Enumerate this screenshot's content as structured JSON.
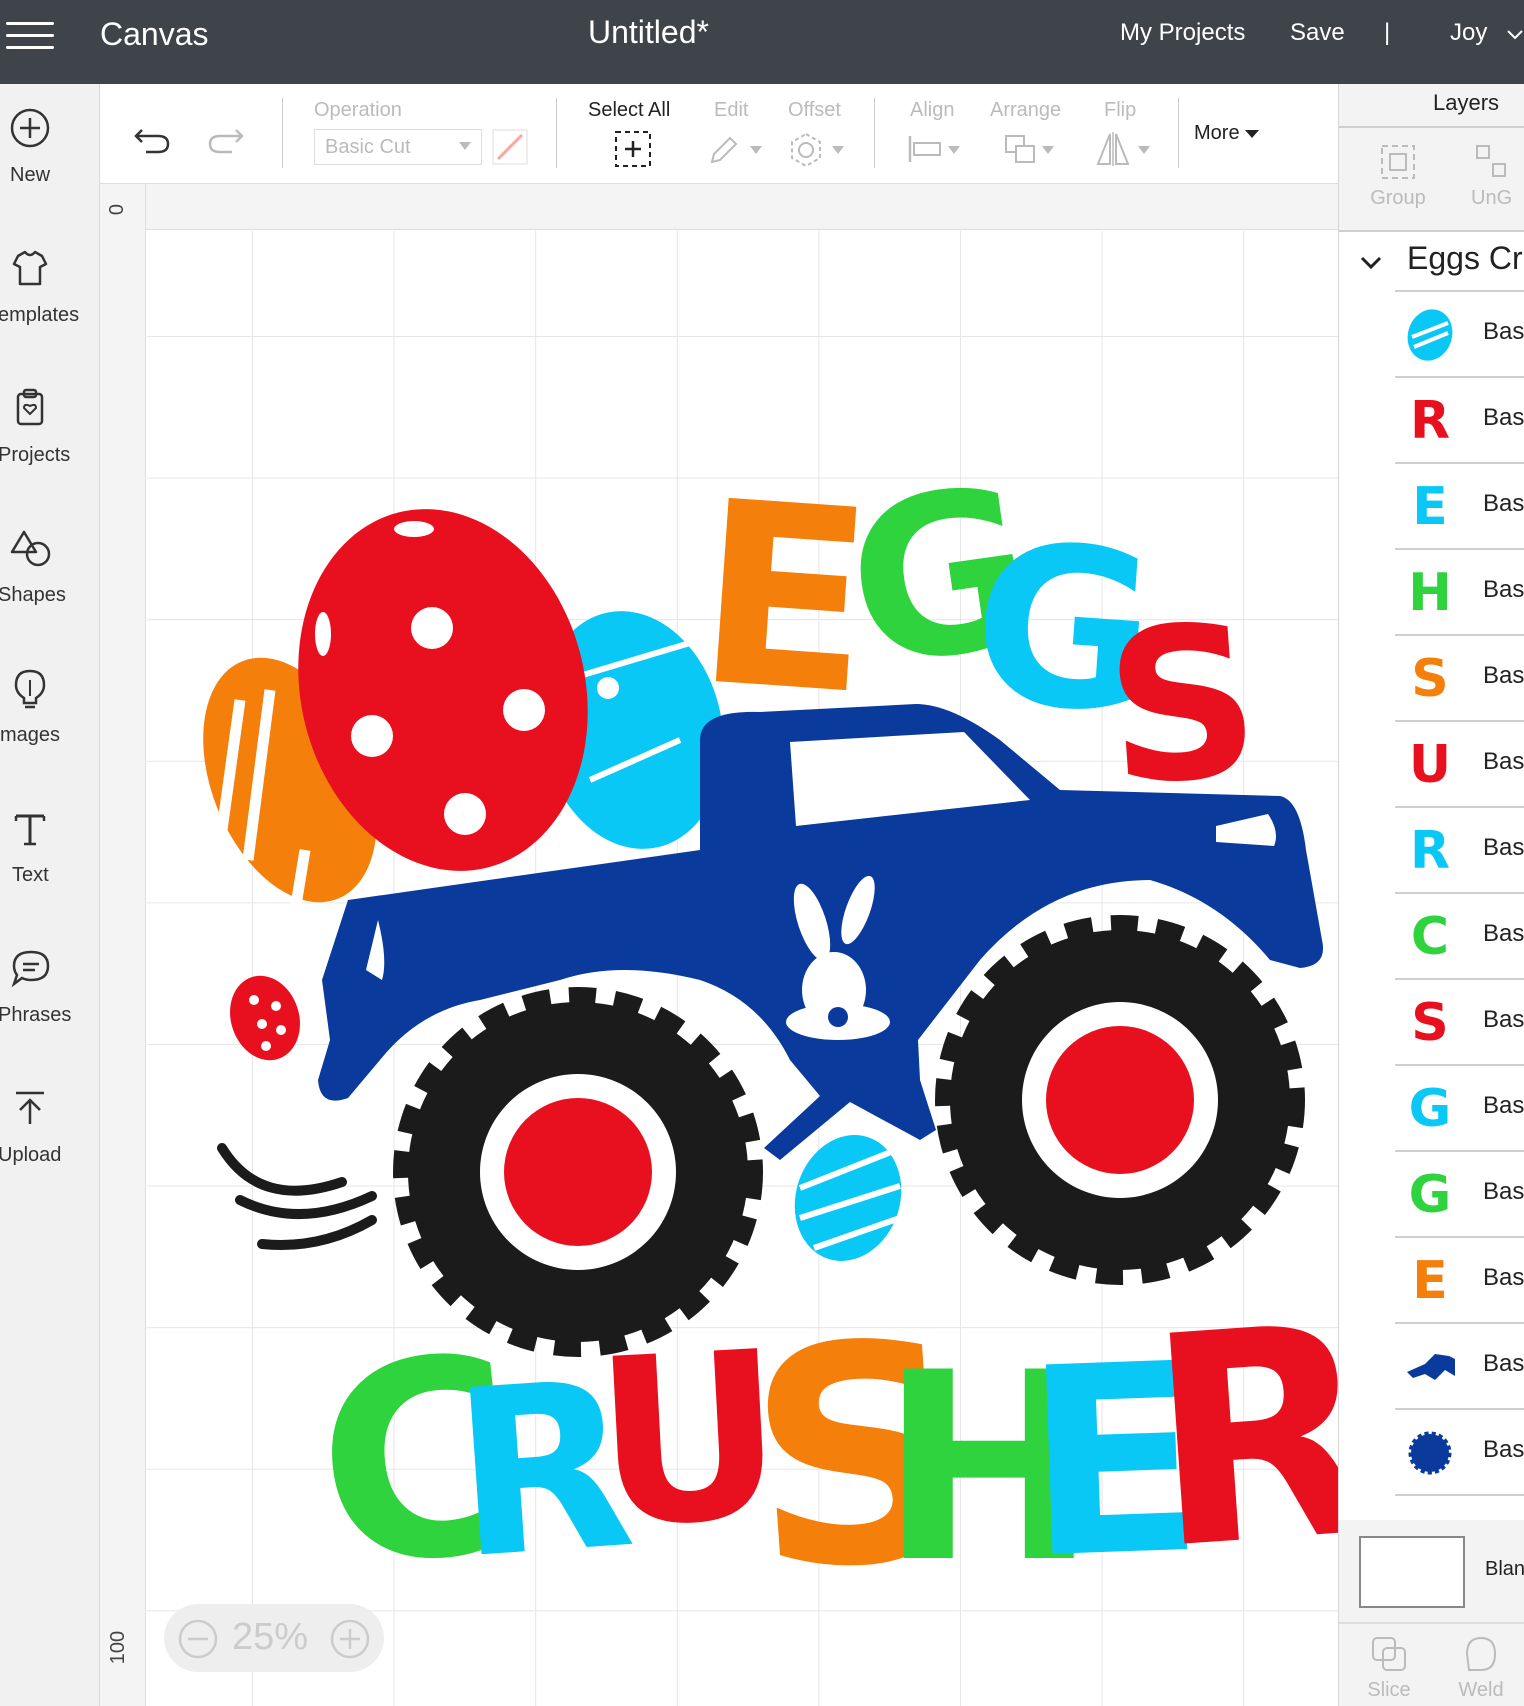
{
  "topbar": {
    "app_title": "Canvas",
    "doc_title": "Untitled*",
    "my_projects": "My Projects",
    "save": "Save",
    "separator": "|",
    "user": "Joy"
  },
  "sidebar": {
    "items": [
      {
        "label": "New",
        "icon": "plus-circle-icon"
      },
      {
        "label": "emplates",
        "icon": "shirt-icon"
      },
      {
        "label": "Projects",
        "icon": "clipboard-heart-icon"
      },
      {
        "label": "Shapes",
        "icon": "shapes-icon"
      },
      {
        "label": "mages",
        "icon": "lightbulb-icon"
      },
      {
        "label": "Text",
        "icon": "text-t-icon"
      },
      {
        "label": "Phrases",
        "icon": "speech-bubble-icon"
      },
      {
        "label": "Upload",
        "icon": "upload-arrow-icon"
      }
    ]
  },
  "toolbar": {
    "operation_label": "Operation",
    "operation_value": "Basic Cut",
    "select_all": "Select All",
    "edit": "Edit",
    "offset": "Offset",
    "align": "Align",
    "arrange": "Arrange",
    "flip": "Flip",
    "more": "More"
  },
  "rulers": {
    "top_zero": "0",
    "left_hundred": "100"
  },
  "zoom": {
    "level": "25%"
  },
  "design": {
    "top_word": [
      "E",
      "G",
      "G",
      "S"
    ],
    "bottom_word": [
      "C",
      "R",
      "U",
      "S",
      "H",
      "E",
      "R"
    ],
    "colors": {
      "orange": "#f57f0b",
      "green": "#2fd33d",
      "cyan": "#0ac8f6",
      "red": "#e8101e",
      "blue": "#0a3a9c",
      "black": "#1b1b1b"
    }
  },
  "layers_panel": {
    "title": "Layers",
    "group": "Group",
    "ungroup": "UnG",
    "group_name": "Eggs Cr",
    "rows": [
      {
        "thumb": "egg",
        "color": "#0ac8f6",
        "label": "Basi"
      },
      {
        "thumb": "R",
        "color": "#e8101e",
        "label": "Basi"
      },
      {
        "thumb": "E",
        "color": "#0ac8f6",
        "label": "Basi"
      },
      {
        "thumb": "H",
        "color": "#2fd33d",
        "label": "Basi"
      },
      {
        "thumb": "S",
        "color": "#f57f0b",
        "label": "Basi"
      },
      {
        "thumb": "U",
        "color": "#e8101e",
        "label": "Basi"
      },
      {
        "thumb": "R",
        "color": "#0ac8f6",
        "label": "Basi"
      },
      {
        "thumb": "C",
        "color": "#2fd33d",
        "label": "Basi"
      },
      {
        "thumb": "S",
        "color": "#e8101e",
        "label": "Basi"
      },
      {
        "thumb": "G",
        "color": "#0ac8f6",
        "label": "Basi"
      },
      {
        "thumb": "G",
        "color": "#2fd33d",
        "label": "Basi"
      },
      {
        "thumb": "E",
        "color": "#f57f0b",
        "label": "Basi"
      },
      {
        "thumb": "truck",
        "color": "#0a3a9c",
        "label": "Basi"
      },
      {
        "thumb": "circle",
        "color": "#0a3a9c",
        "label": "Basi"
      }
    ],
    "blank_label": "Blan",
    "slice": "Slice",
    "weld": "Weld"
  }
}
